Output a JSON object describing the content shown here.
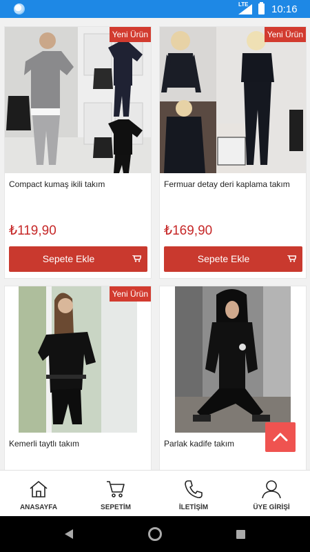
{
  "status_bar": {
    "time": "10:16",
    "network": "LTE"
  },
  "products": [
    {
      "name": "Compact kumaş ikili takım",
      "price": "₺119,90",
      "badge": "Yeni Ürün",
      "button": "Sepete Ekle"
    },
    {
      "name": "Fermuar detay deri kaplama takım",
      "price": "₺169,90",
      "badge": "Yeni Ürün",
      "button": "Sepete Ekle"
    },
    {
      "name": "Kemerli taytlı takım",
      "badge": "Yeni Ürün"
    },
    {
      "name": "Parlak kadife takım"
    }
  ],
  "bottom_nav": [
    {
      "label": "ANASAYFA",
      "icon": "home-icon"
    },
    {
      "label": "SEPETİM",
      "icon": "cart-icon"
    },
    {
      "label": "İLETİŞİM",
      "icon": "phone-icon"
    },
    {
      "label": "ÜYE GİRİŞİ",
      "icon": "user-icon"
    }
  ],
  "colors": {
    "status_bar": "#1e88e5",
    "accent": "#c9392e",
    "price": "#c62828",
    "scroll_top": "#ef5350"
  }
}
